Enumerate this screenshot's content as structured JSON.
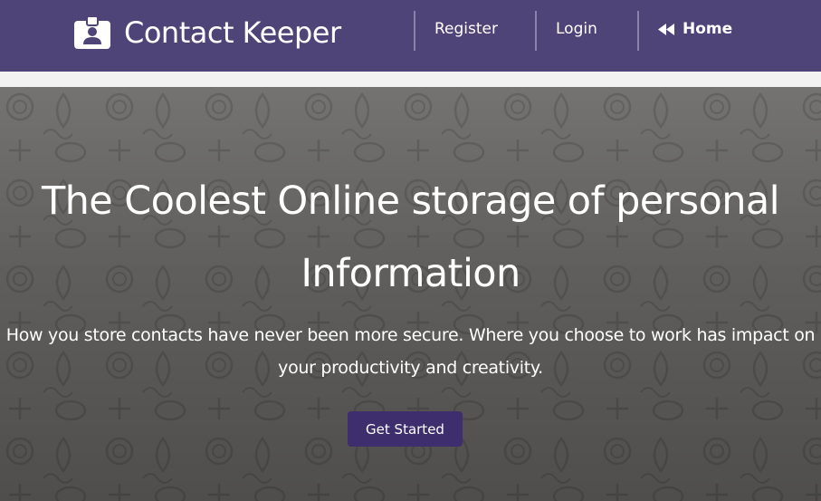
{
  "navbar": {
    "brand_name": "Contact Keeper",
    "brand_icon": "id-badge-icon",
    "links": {
      "register": "Register",
      "login": "Login",
      "home": "Home"
    },
    "home_icon": "backward-icon"
  },
  "hero": {
    "title_line1": "The Coolest Online storage of personal",
    "title_line2": "Information",
    "lead_line1": "How you store contacts have never been more secure. Where you choose to work has impact on",
    "lead_line2": "your productivity and creativity.",
    "cta_label": "Get Started"
  },
  "colors": {
    "navbar": "#4f4478",
    "cta": "#3e2e6e",
    "hero_top": "#747372",
    "hero_bottom": "#4f4e4c"
  }
}
